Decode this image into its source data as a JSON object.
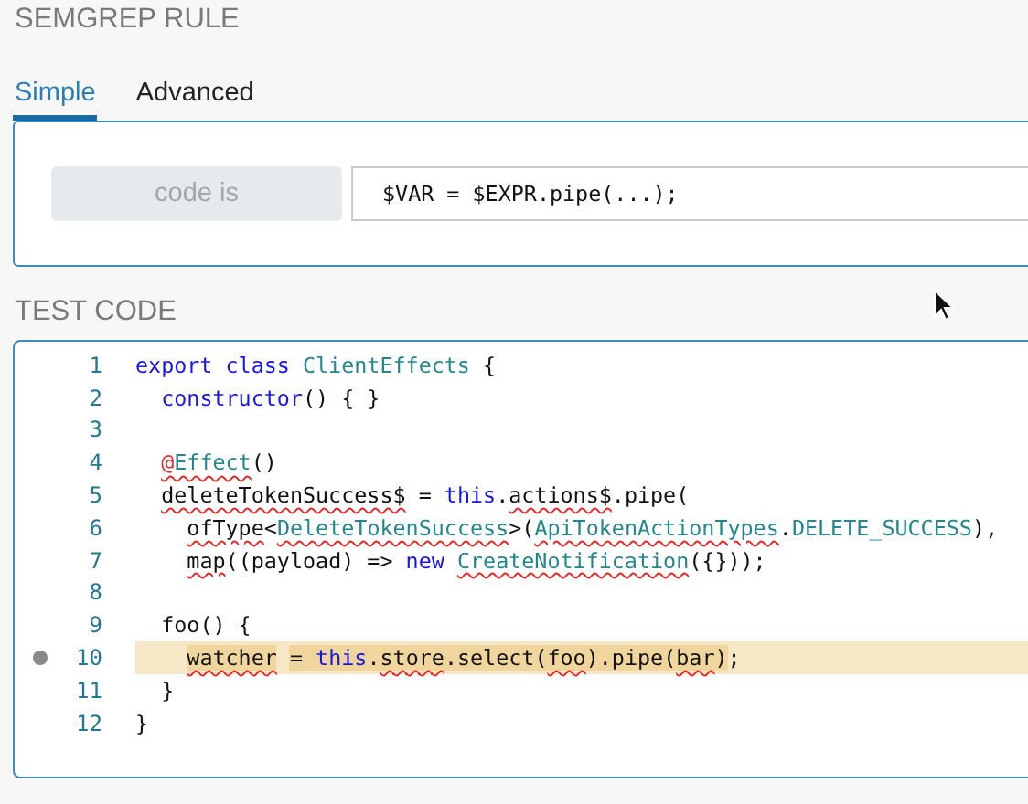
{
  "section_title": "SEMGREP RULE",
  "tabs": [
    {
      "label": "Simple",
      "selected": true
    },
    {
      "label": "Advanced",
      "selected": false
    }
  ],
  "rule": {
    "operator": "code is",
    "pattern": "$VAR = $EXPR.pipe(...);"
  },
  "test_title": "TEST CODE",
  "lines": [
    {
      "number": "1",
      "highlighted": false,
      "marker": false,
      "tokens": [
        {
          "text": "export class ",
          "kind": "keyword",
          "squiggle": false
        },
        {
          "text": "ClientEffects",
          "kind": "type",
          "squiggle": false
        },
        {
          "text": " {",
          "kind": "plain",
          "squiggle": false
        }
      ]
    },
    {
      "number": "2",
      "highlighted": false,
      "marker": false,
      "tokens": [
        {
          "text": "  constructor",
          "kind": "keyword",
          "squiggle": false
        },
        {
          "text": "() { }",
          "kind": "plain",
          "squiggle": false
        }
      ]
    },
    {
      "number": "3",
      "highlighted": false,
      "marker": false
    },
    {
      "number": "4",
      "highlighted": false,
      "marker": false,
      "tokens": [
        {
          "text": "  @",
          "kind": "decorator",
          "squiggle": true
        },
        {
          "text": "Effect",
          "kind": "type",
          "squiggle": true
        },
        {
          "text": "()",
          "kind": "plain",
          "squiggle": false
        }
      ]
    },
    {
      "number": "5",
      "highlighted": false,
      "marker": false,
      "tokens": [
        {
          "text": "  deleteTokenSuccess$",
          "kind": "plain",
          "squiggle": true
        },
        {
          "text": " = ",
          "kind": "plain",
          "squiggle": false
        },
        {
          "text": "this",
          "kind": "keyword",
          "squiggle": false
        },
        {
          "text": ".",
          "kind": "plain",
          "squiggle": false
        },
        {
          "text": "actions$",
          "kind": "plain",
          "squiggle": true
        },
        {
          "text": ".pipe(",
          "kind": "plain",
          "squiggle": false
        }
      ]
    },
    {
      "number": "6",
      "highlighted": false,
      "marker": false,
      "tokens": [
        {
          "text": "    ofType",
          "kind": "plain",
          "squiggle": true
        },
        {
          "text": "<",
          "kind": "plain",
          "squiggle": false
        },
        {
          "text": "DeleteTokenSuccess",
          "kind": "type",
          "squiggle": true
        },
        {
          "text": ">(",
          "kind": "plain",
          "squiggle": false
        },
        {
          "text": "ApiTokenActionTypes",
          "kind": "type",
          "squiggle": true
        },
        {
          "text": ".",
          "kind": "plain",
          "squiggle": false
        },
        {
          "text": "DELETE_SUCCESS",
          "kind": "type",
          "squiggle": false
        },
        {
          "text": "),",
          "kind": "plain",
          "squiggle": false
        }
      ]
    },
    {
      "number": "7",
      "highlighted": false,
      "marker": false,
      "tokens": [
        {
          "text": "    map",
          "kind": "plain",
          "squiggle": true
        },
        {
          "text": "((payload) => ",
          "kind": "plain",
          "squiggle": false
        },
        {
          "text": "new ",
          "kind": "keyword",
          "squiggle": false
        },
        {
          "text": "CreateNotification",
          "kind": "type",
          "squiggle": true
        },
        {
          "text": "({}));",
          "kind": "plain",
          "squiggle": false
        }
      ]
    },
    {
      "number": "8",
      "highlighted": false,
      "marker": false
    },
    {
      "number": "9",
      "highlighted": false,
      "marker": false,
      "tokens": [
        {
          "text": "  foo() {",
          "kind": "plain",
          "squiggle": false
        }
      ]
    },
    {
      "number": "10",
      "highlighted": true,
      "marker": true,
      "tokens": [
        {
          "text": "    watcher",
          "kind": "match",
          "squiggle": true
        },
        {
          "text": " = ",
          "kind": "match",
          "squiggle": false
        },
        {
          "text": "this",
          "kind": "match-keyword",
          "squiggle": false
        },
        {
          "text": ".",
          "kind": "match",
          "squiggle": false
        },
        {
          "text": "store",
          "kind": "match",
          "squiggle": true
        },
        {
          "text": ".select(",
          "kind": "match",
          "squiggle": false
        },
        {
          "text": "foo",
          "kind": "match",
          "squiggle": true
        },
        {
          "text": ").pipe(",
          "kind": "match",
          "squiggle": false
        },
        {
          "text": "bar",
          "kind": "match",
          "squiggle": true
        },
        {
          "text": ")",
          "kind": "match",
          "squiggle": false
        },
        {
          "text": ";",
          "kind": "plain",
          "squiggle": false
        }
      ]
    },
    {
      "number": "11",
      "highlighted": false,
      "marker": false,
      "tokens": [
        {
          "text": "  }",
          "kind": "plain",
          "squiggle": false
        }
      ]
    },
    {
      "number": "12",
      "highlighted": false,
      "marker": false,
      "tokens": [
        {
          "text": "}",
          "kind": "plain",
          "squiggle": false
        }
      ]
    }
  ]
}
